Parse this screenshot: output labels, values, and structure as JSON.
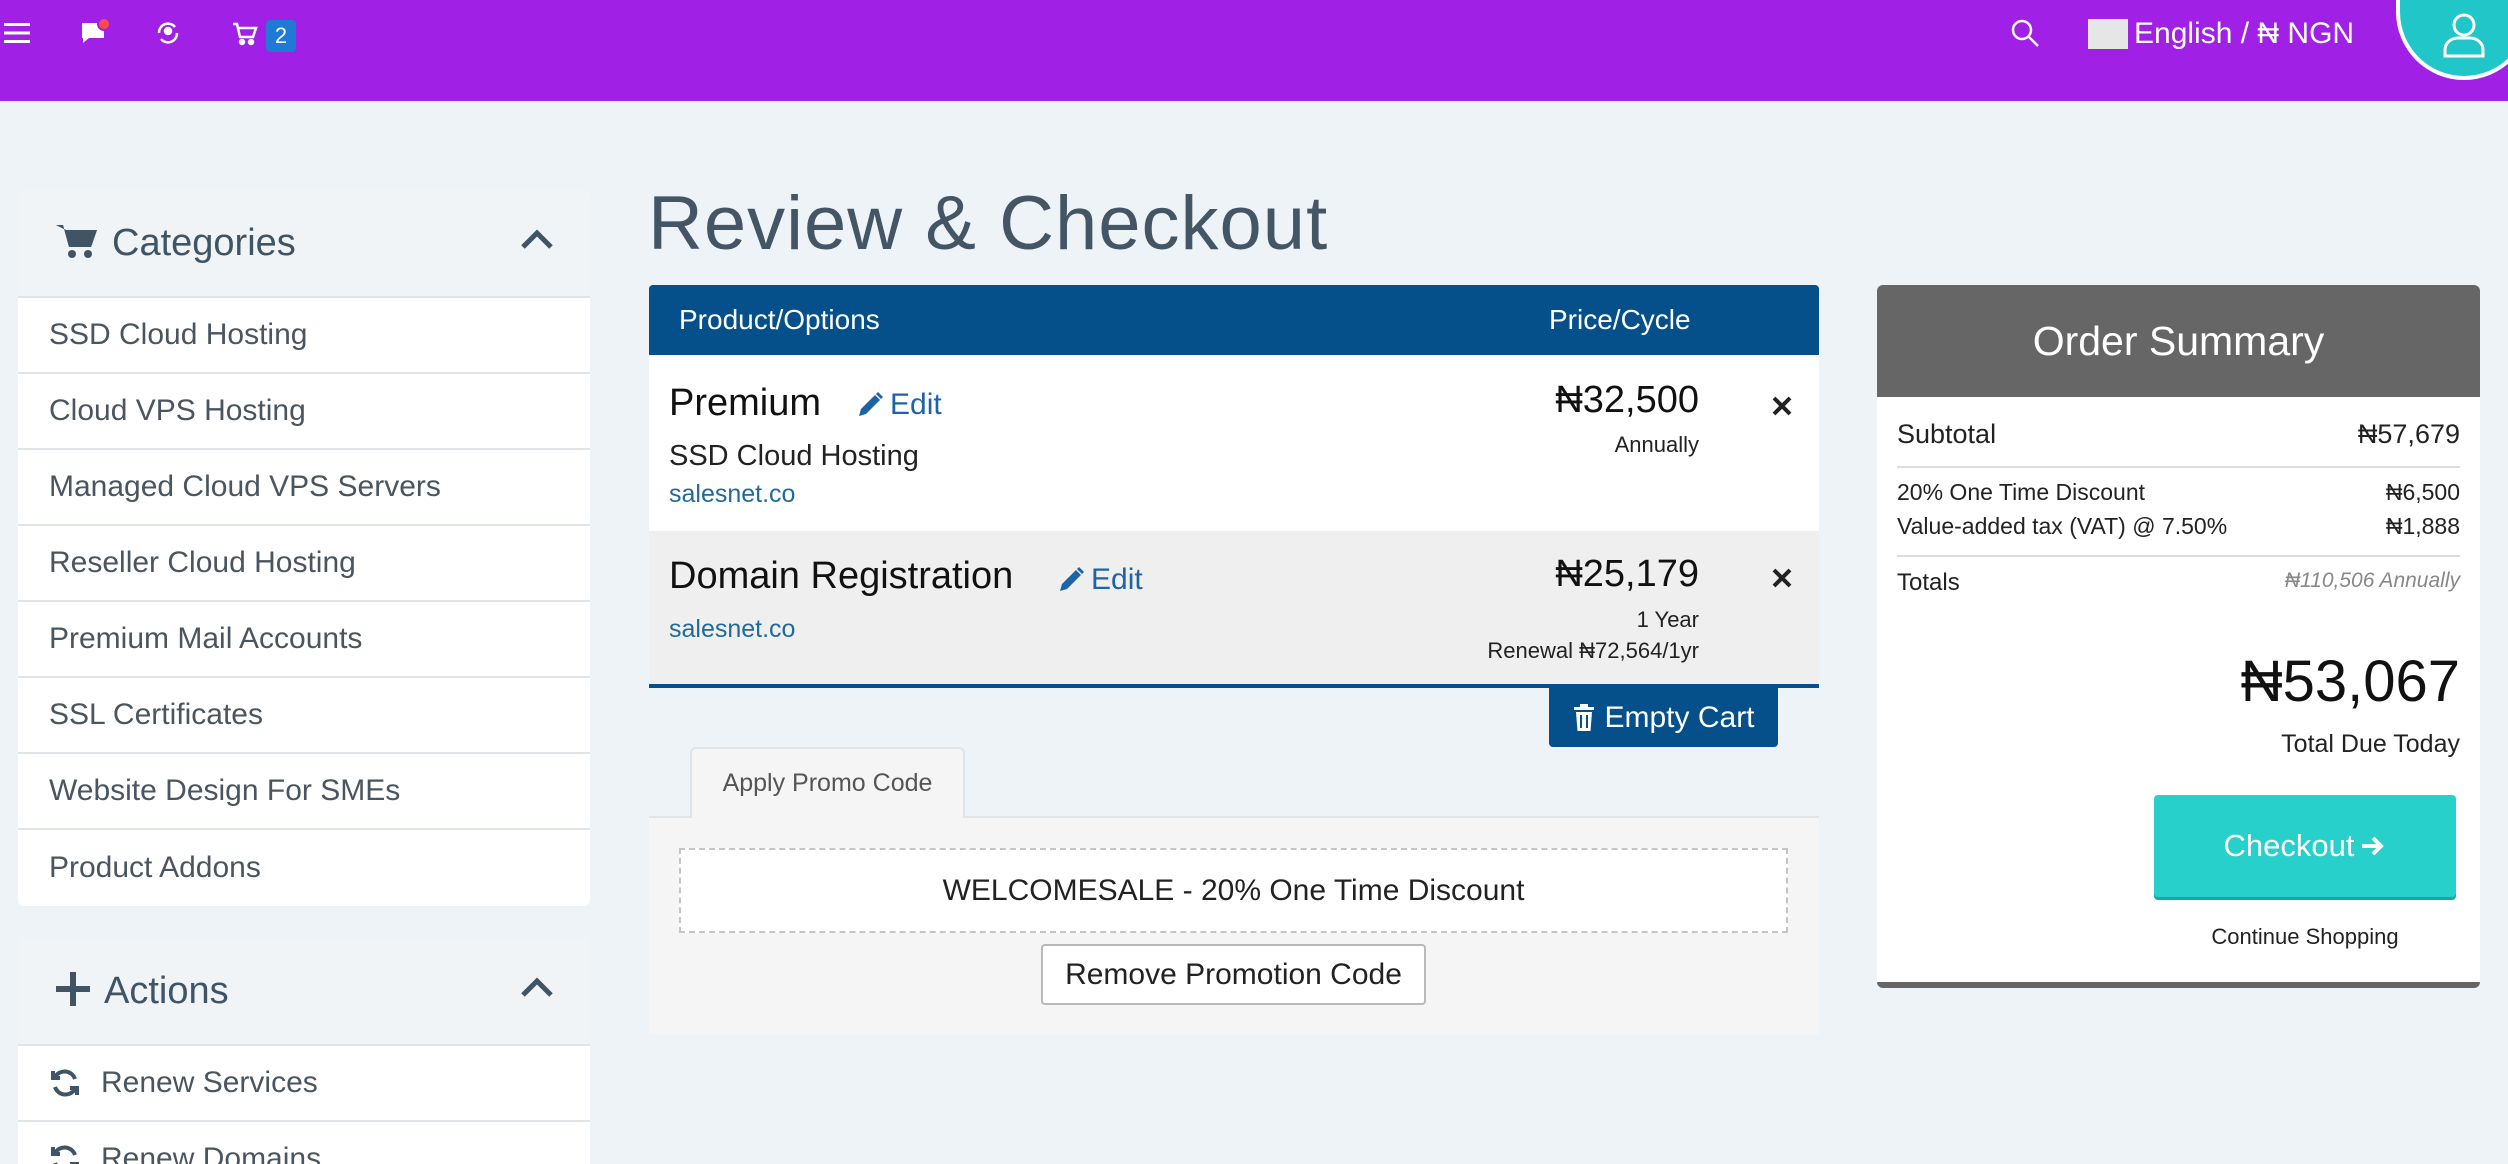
{
  "topbar": {
    "cart_count": "2",
    "language_label": "English / ₦ NGN"
  },
  "sidebar": {
    "categories_title": "Categories",
    "categories": [
      "SSD Cloud Hosting",
      "Cloud VPS Hosting",
      "Managed Cloud VPS Servers",
      "Reseller Cloud Hosting",
      "Premium Mail Accounts",
      "SSL Certificates",
      "Website Design For SMEs",
      "Product Addons"
    ],
    "actions_title": "Actions",
    "actions": [
      "Renew Services",
      "Renew Domains"
    ]
  },
  "main": {
    "title": "Review & Checkout",
    "col_product": "Product/Options",
    "col_price": "Price/Cycle",
    "items": [
      {
        "name": "Premium",
        "edit": "Edit",
        "group": "SSD Cloud Hosting",
        "domain": "salesnet.co",
        "price": "₦32,500",
        "cycle": "Annually"
      },
      {
        "name": "Domain Registration",
        "edit": "Edit",
        "domain": "salesnet.co",
        "price": "₦25,179",
        "cycle": "1 Year",
        "renewal": "Renewal ₦72,564/1yr"
      }
    ],
    "empty_cart": "Empty Cart",
    "promo_tab": "Apply Promo Code",
    "promo_applied": "WELCOMESALE - 20% One Time Discount",
    "remove_promo": "Remove Promotion Code"
  },
  "summary": {
    "title": "Order Summary",
    "subtotal_label": "Subtotal",
    "subtotal_value": "₦57,679",
    "discount_label": "20% One Time Discount",
    "discount_value": "₦6,500",
    "vat_label": "Value-added tax (VAT) @ 7.50%",
    "vat_value": "₦1,888",
    "totals_label": "Totals",
    "totals_value": "₦110,506 Annually",
    "total_due": "₦53,067",
    "total_due_label": "Total Due Today",
    "checkout": "Checkout",
    "continue": "Continue Shopping"
  },
  "colors": {
    "topbar": "#a020e5",
    "table_header": "#05508a",
    "checkout": "#27d0cb",
    "summary_header": "#666666"
  }
}
